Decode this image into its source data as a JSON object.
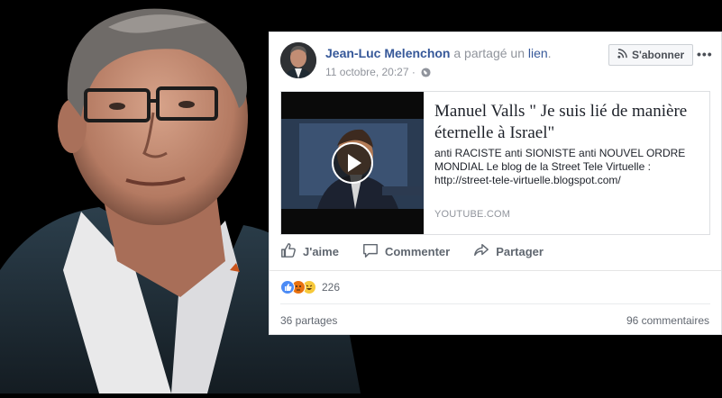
{
  "post": {
    "author_name": "Jean-Luc Melenchon",
    "shared_text": " a partagé un ",
    "link_word": "lien",
    "period": ".",
    "timestamp": "11 octobre, 20:27 ·",
    "subscribe_label": "S'abonner",
    "more_label": "•••"
  },
  "preview": {
    "title": "Manuel Valls \" Je suis lié de manière éternelle à Israel\"",
    "description": "anti RACISTE anti SIONISTE anti NOUVEL ORDRE MONDIAL Le blog de la Street Tele Virtuelle : http://street-tele-virtuelle.blogspot.com/",
    "source": "YOUTUBE.COM"
  },
  "actions": {
    "like": "J'aime",
    "comment": "Commenter",
    "share": "Partager"
  },
  "stats": {
    "reaction_count": "226",
    "shares": "36 partages",
    "comments": "96 commentaires"
  },
  "colors": {
    "link_blue": "#365899",
    "like_blue": "#4c8bf5",
    "angry_orange": "#e9710f",
    "haha_yellow": "#f7c93b"
  }
}
